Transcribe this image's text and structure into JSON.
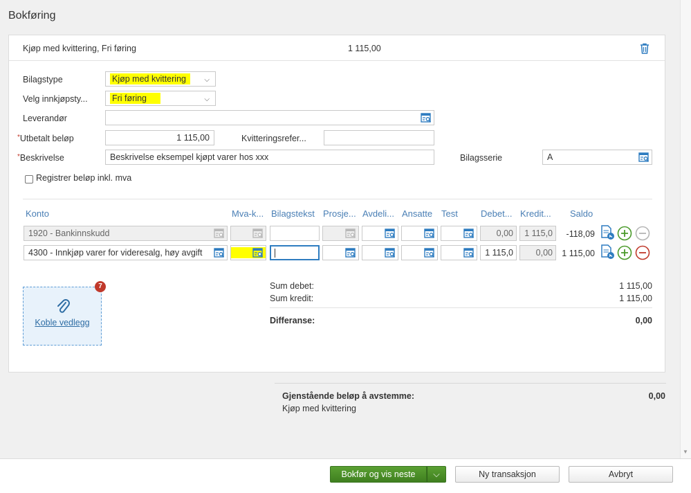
{
  "page": {
    "title": "Bokføring"
  },
  "transaction": {
    "title": "Kjøp med kvittering, Fri føring",
    "amount": "1 115,00"
  },
  "form": {
    "bilagstype": {
      "label": "Bilagstype",
      "value": "Kjøp med kvittering"
    },
    "innkjopstype": {
      "label": "Velg innkjøpsty...",
      "value": "Fri føring"
    },
    "leverandor": {
      "label": "Leverandør",
      "value": ""
    },
    "utbetalt": {
      "required_mark": "*",
      "label": "Utbetalt beløp",
      "value": "1 115,00"
    },
    "kvittering": {
      "label": "Kvitteringsrefer...",
      "value": ""
    },
    "beskrivelse": {
      "required_mark": "*",
      "label": "Beskrivelse",
      "value": "Beskrivelse eksempel kjøpt varer hos xxx"
    },
    "bilagsserie": {
      "label": "Bilagsserie",
      "value": "A"
    },
    "registrer": {
      "label": "Registrer beløp inkl. mva",
      "checked": false
    }
  },
  "table": {
    "columns": [
      "Konto",
      "Mva-k...",
      "Bilagstekst",
      "Prosje...",
      "Avdeli...",
      "Ansatte",
      "Test",
      "Debet...",
      "Kredit...",
      "Saldo"
    ],
    "rows": [
      {
        "konto": "1920 - Bankinnskudd",
        "bilagstekst": "",
        "debet": "0,00",
        "kredit": "1 115,0",
        "saldo": "-118,09",
        "disabled": true
      },
      {
        "konto": "4300 - Innkjøp varer for videresalg, høy avgift",
        "bilagstekst": "",
        "debet": "1 115,0",
        "kredit": "0,00",
        "saldo": "1 115,00",
        "disabled": false
      }
    ]
  },
  "attachment": {
    "badge": "7",
    "label": "Koble vedlegg"
  },
  "summary": {
    "sum_debet_label": "Sum debet:",
    "sum_debet": "1 115,00",
    "sum_kredit_label": "Sum kredit:",
    "sum_kredit": "1 115,00",
    "differanse_label": "Differanse:",
    "differanse": "0,00"
  },
  "remaining": {
    "label": "Gjenstående beløp å avstemme:",
    "value": "0,00",
    "sub": "Kjøp med kvittering"
  },
  "buttons": {
    "primary": "Bokfør og vis neste",
    "new": "Ny transaksjon",
    "cancel": "Avbryt"
  },
  "colors": {
    "accent": "#4a7fb5",
    "primary_button": "#4a8f26",
    "highlight": "#ffff00",
    "danger": "#c0392b"
  }
}
